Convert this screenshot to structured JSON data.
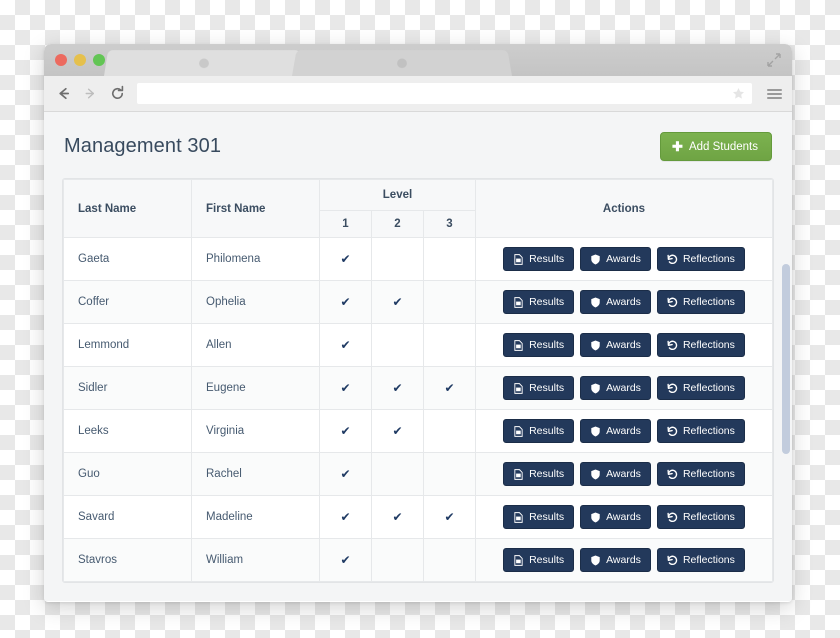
{
  "browser": {
    "traffic_lights": [
      "close",
      "minimize",
      "zoom"
    ],
    "tabs": [
      {
        "label": ""
      },
      {
        "label": ""
      }
    ],
    "toolbar": {
      "back_icon": "arrow-left-icon",
      "forward_icon": "arrow-right-icon",
      "reload_icon": "reload-icon",
      "url_value": "",
      "url_placeholder": "",
      "bookmark_icon": "star-icon",
      "menu_icon": "hamburger-menu-icon"
    },
    "maximize_icon": "maximize-icon"
  },
  "page": {
    "title": "Management 301",
    "add_students_button": {
      "label": "Add Students",
      "icon": "plus-icon",
      "color": "#6fa444"
    },
    "table": {
      "headers": {
        "last_name": "Last Name",
        "first_name": "First Name",
        "level_group": "Level",
        "levels": [
          "1",
          "2",
          "3"
        ],
        "actions": "Actions"
      },
      "action_buttons": [
        {
          "label": "Results",
          "icon": "file-pdf-icon"
        },
        {
          "label": "Awards",
          "icon": "shield-icon"
        },
        {
          "label": "Reflections",
          "icon": "undo-rotate-icon"
        }
      ],
      "check_mark": "✔",
      "rows": [
        {
          "last_name": "Gaeta",
          "first_name": "Philomena",
          "levels": [
            true,
            false,
            false
          ]
        },
        {
          "last_name": "Coffer",
          "first_name": "Ophelia",
          "levels": [
            true,
            true,
            false
          ]
        },
        {
          "last_name": "Lemmond",
          "first_name": "Allen",
          "levels": [
            true,
            false,
            false
          ]
        },
        {
          "last_name": "Sidler",
          "first_name": "Eugene",
          "levels": [
            true,
            true,
            true
          ]
        },
        {
          "last_name": "Leeks",
          "first_name": "Virginia",
          "levels": [
            true,
            true,
            false
          ]
        },
        {
          "last_name": "Guo",
          "first_name": "Rachel",
          "levels": [
            true,
            false,
            false
          ]
        },
        {
          "last_name": "Savard",
          "first_name": "Madeline",
          "levels": [
            true,
            true,
            true
          ]
        },
        {
          "last_name": "Stavros",
          "first_name": "William",
          "levels": [
            true,
            false,
            false
          ]
        }
      ]
    }
  },
  "colors": {
    "accent_green": "#6fa444",
    "action_navy": "#23395b",
    "title_text": "#384a5e",
    "scrollbar_thumb": "#b9c4d8"
  }
}
